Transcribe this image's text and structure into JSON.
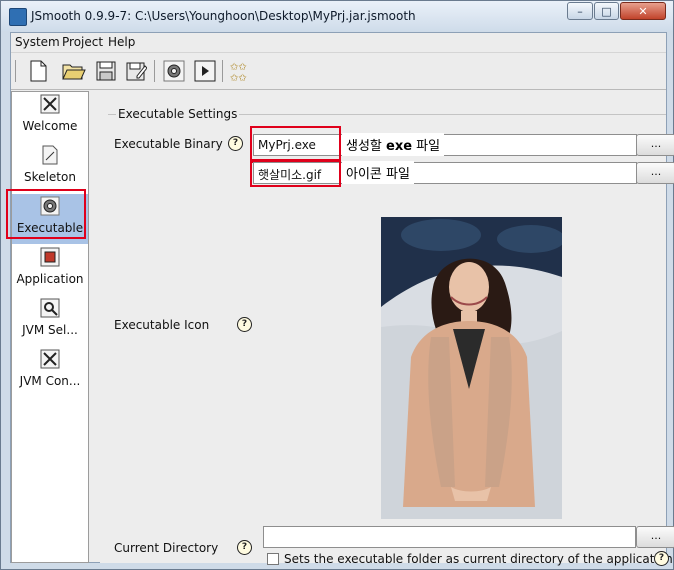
{
  "window": {
    "title": "JSmooth 0.9.9-7: C:\\Users\\Younghoon\\Desktop\\MyPrj.jar.jsmooth",
    "minimize": "–",
    "maximize": "□",
    "close": "✕"
  },
  "menu": [
    "System",
    "Project",
    "Help"
  ],
  "toolbar": {
    "icons": [
      "new-file-icon",
      "open-folder-icon",
      "save-icon",
      "save-as-icon",
      "gear-icon",
      "run-icon",
      "stars-icon"
    ]
  },
  "sidebar": {
    "items": [
      {
        "label": "Welcome",
        "icon": "welcome-icon"
      },
      {
        "label": "Skeleton",
        "icon": "skeleton-icon"
      },
      {
        "label": "Executable",
        "icon": "gear-icon",
        "selected": true
      },
      {
        "label": "Application",
        "icon": "application-icon"
      },
      {
        "label": "JVM Sel...",
        "icon": "jvm-search-icon"
      },
      {
        "label": "JVM Con...",
        "icon": "jvm-config-icon"
      }
    ]
  },
  "panel": {
    "group_title": "Executable Settings",
    "executable_binary": {
      "label": "Executable Binary",
      "value": "MyPrj.exe",
      "annotation_pre": "생성할 ",
      "annotation_bold": "exe",
      "annotation_post": " 파일"
    },
    "icon_file": {
      "value": "햇살미소.gif",
      "annotation": "아이콘 파일"
    },
    "executable_icon_label": "Executable Icon",
    "current_directory": {
      "label": "Current Directory",
      "value": "",
      "checkbox_label": "Sets the executable folder as current directory of the application.",
      "checked": false
    },
    "browse_label": "...",
    "help_glyph": "?"
  },
  "colors": {
    "highlight": "#e0001b",
    "selection": "#a9c3e6"
  }
}
